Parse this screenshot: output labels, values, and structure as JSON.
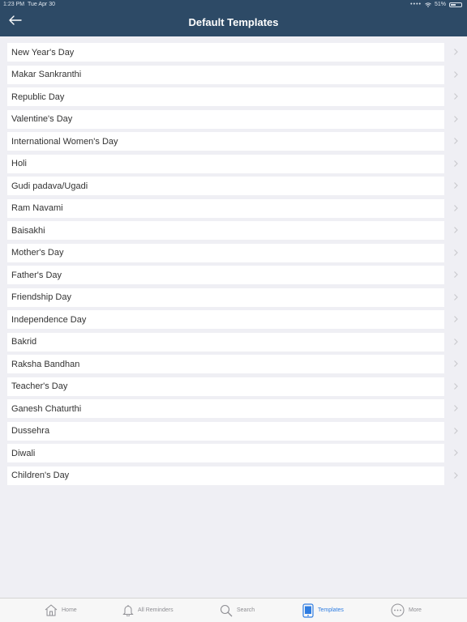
{
  "status_bar": {
    "time": "1:23 PM",
    "date": "Tue Apr 30",
    "battery": "51%"
  },
  "header": {
    "title": "Default Templates",
    "back_icon": "arrow-left-icon"
  },
  "templates": [
    "New Year's Day",
    "Makar Sankranthi",
    "Republic Day",
    "Valentine's Day",
    "International Women's Day",
    "Holi",
    "Gudi padava/Ugadi",
    "Ram Navami",
    "Baisakhi",
    "Mother's Day",
    "Father's Day",
    "Friendship Day",
    "Independence Day",
    "Bakrid",
    "Raksha Bandhan",
    "Teacher's Day",
    "Ganesh Chaturthi",
    "Dussehra",
    "Diwali",
    "Children's Day"
  ],
  "tabs": [
    {
      "label": "Home",
      "icon": "home-icon"
    },
    {
      "label": "All Reminders",
      "icon": "bell-icon"
    },
    {
      "label": "Search",
      "icon": "search-icon"
    },
    {
      "label": "Templates",
      "icon": "phone-templates-icon"
    },
    {
      "label": "More",
      "icon": "more-icon"
    }
  ],
  "colors": {
    "header": "#2d4a66",
    "accent": "#2f7de1",
    "background": "#efeff4"
  }
}
